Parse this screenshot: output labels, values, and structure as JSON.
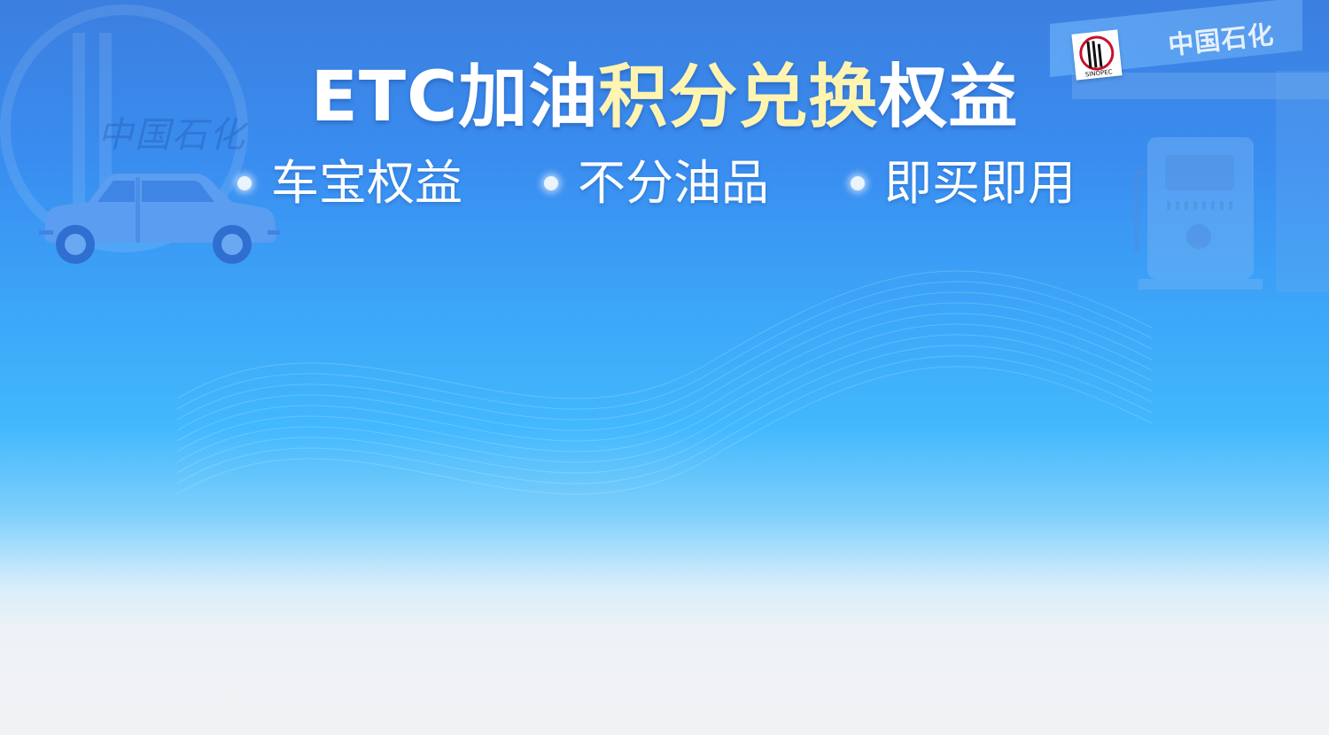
{
  "headline": {
    "part1": "ETC加油",
    "part2": "积分兑换",
    "part3": "权益"
  },
  "features": [
    "车宝权益",
    "不分油品",
    "即买即用"
  ],
  "brand": {
    "name": "中国石化",
    "logo_text": "SINOPEC"
  },
  "watermark": {
    "text": "中国石化"
  },
  "colors": {
    "highlight": "#fff4b0",
    "primary": "#3a8df0"
  },
  "icons": [
    "car-icon",
    "sinopec-logo-icon",
    "fuel-pump-icon"
  ]
}
